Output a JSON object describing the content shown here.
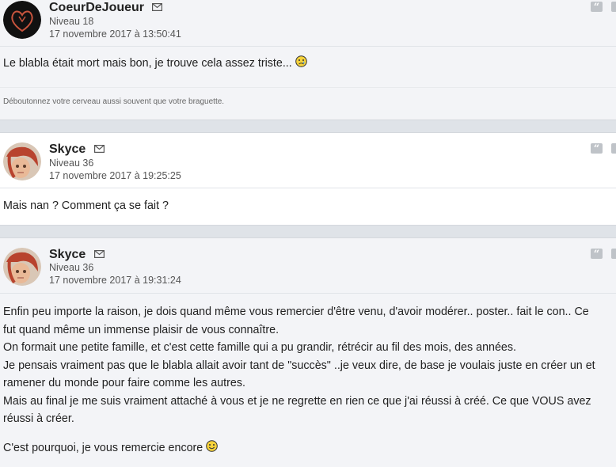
{
  "posts": [
    {
      "username": "CoeurDeJoueur",
      "level": "Niveau 18",
      "date": "17 novembre 2017 à 13:50:41",
      "message": "Le blabla était mort mais bon, je trouve cela assez triste...",
      "signature": "Déboutonnez votre cerveau aussi souvent que votre braguette."
    },
    {
      "username": "Skyce",
      "level": "Niveau 36",
      "date": "17 novembre 2017 à 19:25:25",
      "message": "Mais nan ? Comment ça se fait ?"
    },
    {
      "username": "Skyce",
      "level": "Niveau 36",
      "date": "17 novembre 2017 à 19:31:24",
      "lines": [
        "Enfin peu importe la raison, je dois quand même vous remercier d'être venu, d'avoir modérer.. poster.. fait le con.. Ce",
        "fut quand même un immense plaisir de vous connaître.",
        "On formait une petite famille, et c'est cette famille qui a pu grandir, rétrécir au fil des mois, des années.",
        "Je pensais vraiment pas que le blabla allait avoir tant de \"succès\" ..je veux dire, de base je voulais juste en créer un et",
        "ramener du monde pour faire comme les autres.",
        "Mais au final je me suis vraiment attaché à vous et je ne regrette en rien ce que j'ai réussi à créé. Ce que VOUS avez",
        "réussi à créer."
      ],
      "closing": "C'est pourquoi, je vous remercie encore"
    }
  ],
  "icons": {
    "mail": "envelope-icon",
    "quote": "quote-icon",
    "sad_smiley": "sad-smiley-icon",
    "happy_smiley": "happy-smiley-icon"
  },
  "colors": {
    "alt_bg": "#f3f4f7",
    "page_bg": "#dfe3e8"
  }
}
